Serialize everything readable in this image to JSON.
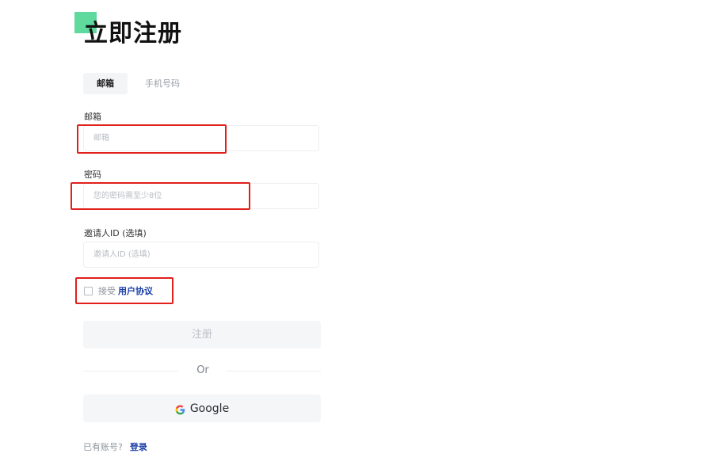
{
  "page": {
    "title": "立即注册"
  },
  "tabs": [
    {
      "label": "邮箱",
      "active": true
    },
    {
      "label": "手机号码",
      "active": false
    }
  ],
  "form": {
    "email": {
      "label": "邮箱",
      "placeholder": "邮箱",
      "value": ""
    },
    "password": {
      "label": "密码",
      "placeholder": "您的密码需至少8位",
      "value": ""
    },
    "inviter": {
      "label": "邀请人ID (选填)",
      "placeholder": "邀请人ID (选填)",
      "value": ""
    },
    "agreement": {
      "checked": false,
      "prefix": "接受",
      "link_label": "用户协议"
    },
    "submit_label": "注册"
  },
  "divider": {
    "label": "Or"
  },
  "google": {
    "label": "Google",
    "icon": "google-icon"
  },
  "footer": {
    "prompt": "已有账号?",
    "login_label": "登录"
  },
  "colors": {
    "accent_square": "#5fd99e",
    "highlight_box": "#e0201b",
    "link": "#1c3fa7",
    "button_bg": "#f5f6f8"
  }
}
